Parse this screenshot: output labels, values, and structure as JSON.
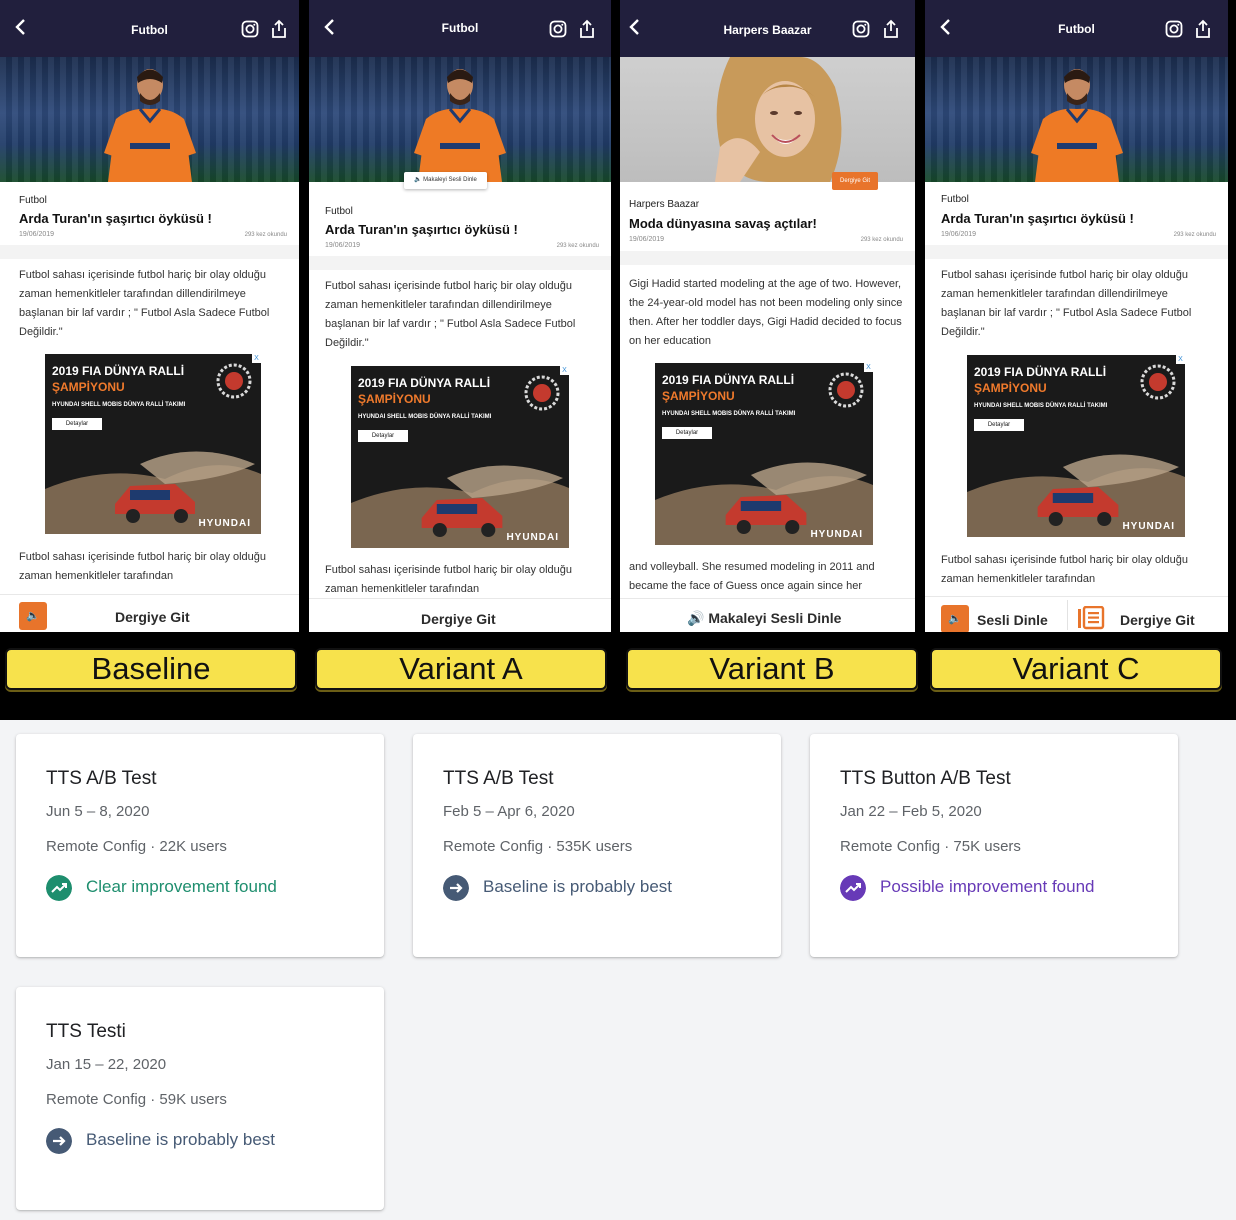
{
  "phones": [
    {
      "label": "Baseline",
      "header_title": "Futbol",
      "category": "Futbol",
      "headline": "Arda Turan'ın şaşırtıcı öyküsü !",
      "date": "19/06/2019",
      "reads": "293 kez okundu",
      "body_1": "Futbol sahası içerisinde futbol hariç bir olay olduğu zaman hemenkitleler tarafından dillendirilmeye başlanan bir laf vardır ; \" Futbol Asla Sadece Futbol Değildir.\"",
      "body_2": "Futbol sahası içerisinde futbol hariç bir olay olduğu zaman hemenkitleler tarafından",
      "bar_label": "Dergiye Git"
    },
    {
      "label": "Variant A",
      "header_title": "Futbol",
      "chip": "Makaleyi Sesli Dinle",
      "category": "Futbol",
      "headline": "Arda Turan'ın şaşırtıcı öyküsü !",
      "date": "19/06/2019",
      "reads": "293 kez okundu",
      "body_1": "Futbol sahası içerisinde futbol hariç bir olay olduğu zaman hemenkitleler tarafından dillendirilmeye başlanan bir laf vardır ; \" Futbol Asla Sadece Futbol Değildir.\"",
      "body_2": "Futbol sahası içerisinde futbol hariç bir olay olduğu zaman hemenkitleler tarafından",
      "bar_label": "Dergiye Git"
    },
    {
      "label": "Variant B",
      "header_title": "Harpers Baazar",
      "chip": "Dergiye Git",
      "category": "Harpers Baazar",
      "headline": "Moda dünyasına savaş açtılar!",
      "date": "19/06/2019",
      "reads": "293 kez okundu",
      "body_1": "Gigi Hadid started modeling at the age of two. However, the 24-year-old model has not been modeling only since then.  After her toddler days, Gigi Hadid decided to focus on her education",
      "body_2": "and volleyball. She resumed modeling in 2011 and became the face of Guess once again since her",
      "bar_label": "Makaleyi Sesli Dinle"
    },
    {
      "label": "Variant C",
      "header_title": "Futbol",
      "category": "Futbol",
      "headline": "Arda Turan'ın şaşırtıcı öyküsü !",
      "date": "19/06/2019",
      "reads": "293 kez okundu",
      "body_1": "Futbol sahası içerisinde futbol hariç bir olay olduğu zaman hemenkitleler tarafından dillendirilmeye başlanan bir laf vardır ; \" Futbol Asla Sadece Futbol Değildir.\"",
      "body_2": "Futbol sahası içerisinde futbol hariç bir olay olduğu zaman hemenkitleler tarafından",
      "bar_label_left": "Sesli Dinle",
      "bar_label": "Dergiye Git"
    }
  ],
  "ad": {
    "title": "2019 FIA DÜNYA RALLİ",
    "subtitle": "ŞAMPİYONU",
    "team": "HYUNDAI SHELL MOBIS DÜNYA RALLİ TAKIMI",
    "button": "Detaylar",
    "brand": "HYUNDAI",
    "close": "X"
  },
  "experiments": [
    {
      "title": "TTS A/B Test",
      "dates": "Jun 5 – 8, 2020",
      "meta": "Remote Config · 22K users",
      "result": "Clear improvement found",
      "status": "improvement",
      "color": "#1e8e6e"
    },
    {
      "title": "TTS A/B Test",
      "dates": "Feb 5 – Apr 6, 2020",
      "meta": "Remote Config · 535K users",
      "result": "Baseline is probably best",
      "status": "baseline",
      "color": "#465a75"
    },
    {
      "title": "TTS Button A/B Test",
      "dates": "Jan 22 – Feb 5, 2020",
      "meta": "Remote Config · 75K users",
      "result": "Possible improvement found",
      "status": "possible",
      "color": "#673ab7"
    },
    {
      "title": "TTS Testi",
      "dates": "Jan 15 – 22, 2020",
      "meta": "Remote Config · 59K users",
      "result": "Baseline is probably best",
      "status": "baseline",
      "color": "#465a75"
    }
  ],
  "colors": {
    "header": "#211f3d",
    "accent": "#e8742b",
    "label_bg": "#f7e24c"
  }
}
